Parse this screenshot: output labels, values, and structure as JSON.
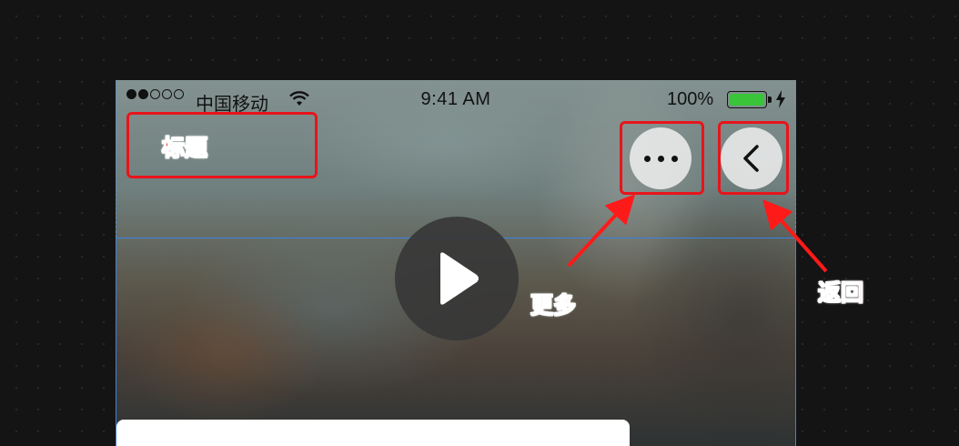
{
  "status_bar": {
    "carrier": "中国移动",
    "time": "9:41 AM",
    "battery_percent": "100%",
    "signal_bars_filled": 2,
    "signal_bars_total": 5
  },
  "nav": {
    "more_icon": "more-dots-icon",
    "back_icon": "chevron-left-icon"
  },
  "player": {
    "play_icon": "play-icon"
  },
  "annotations": {
    "title": "标题",
    "more": "更多",
    "back": "返回"
  },
  "colors": {
    "annotation": "#e8141b",
    "guide": "#3b82e0",
    "battery": "#3ac43a",
    "canvas": "#141414"
  }
}
